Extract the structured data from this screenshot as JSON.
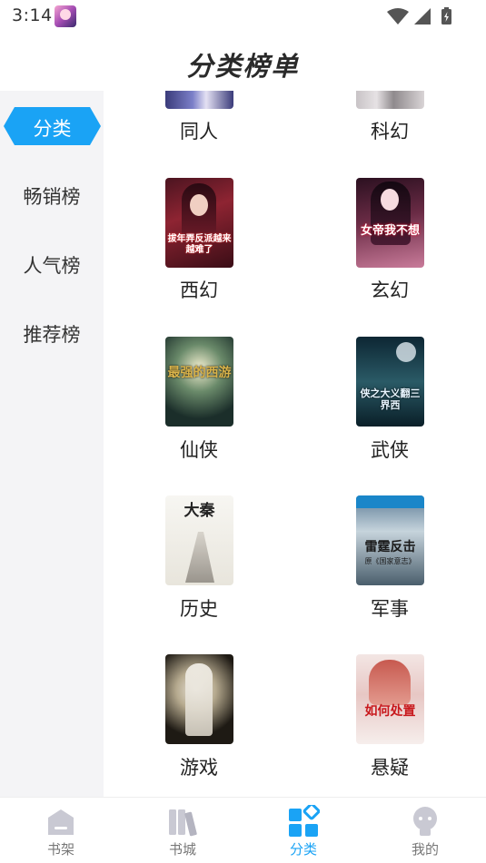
{
  "status_bar": {
    "time": "3:14"
  },
  "header": {
    "title": "分类榜单"
  },
  "sidebar": {
    "items": [
      {
        "label": "分类",
        "active": true
      },
      {
        "label": "畅销榜",
        "active": false
      },
      {
        "label": "人气榜",
        "active": false
      },
      {
        "label": "推荐榜",
        "active": false
      }
    ]
  },
  "categories": [
    {
      "label": "同人"
    },
    {
      "label": "科幻"
    },
    {
      "label": "西幻",
      "cover_text": "拔年弄反派越来越难了"
    },
    {
      "label": "玄幻",
      "cover_text": "女帝我不想"
    },
    {
      "label": "仙侠",
      "cover_text": "最强的西游"
    },
    {
      "label": "武侠",
      "cover_text": "侠之大义翻三界西"
    },
    {
      "label": "历史",
      "cover_text": "大秦"
    },
    {
      "label": "军事",
      "cover_text": "雷霆反击",
      "cover_subtext": "原《国家意志》"
    },
    {
      "label": "游戏"
    },
    {
      "label": "悬疑",
      "cover_text": "如何处置"
    }
  ],
  "bottom_nav": {
    "items": [
      {
        "label": "书架",
        "active": false
      },
      {
        "label": "书城",
        "active": false
      },
      {
        "label": "分类",
        "active": true
      },
      {
        "label": "我的",
        "active": false
      }
    ]
  },
  "colors": {
    "accent": "#1aa3f5",
    "sidebar_bg": "#f4f4f6",
    "inactive_icon": "#c9c9d3"
  }
}
